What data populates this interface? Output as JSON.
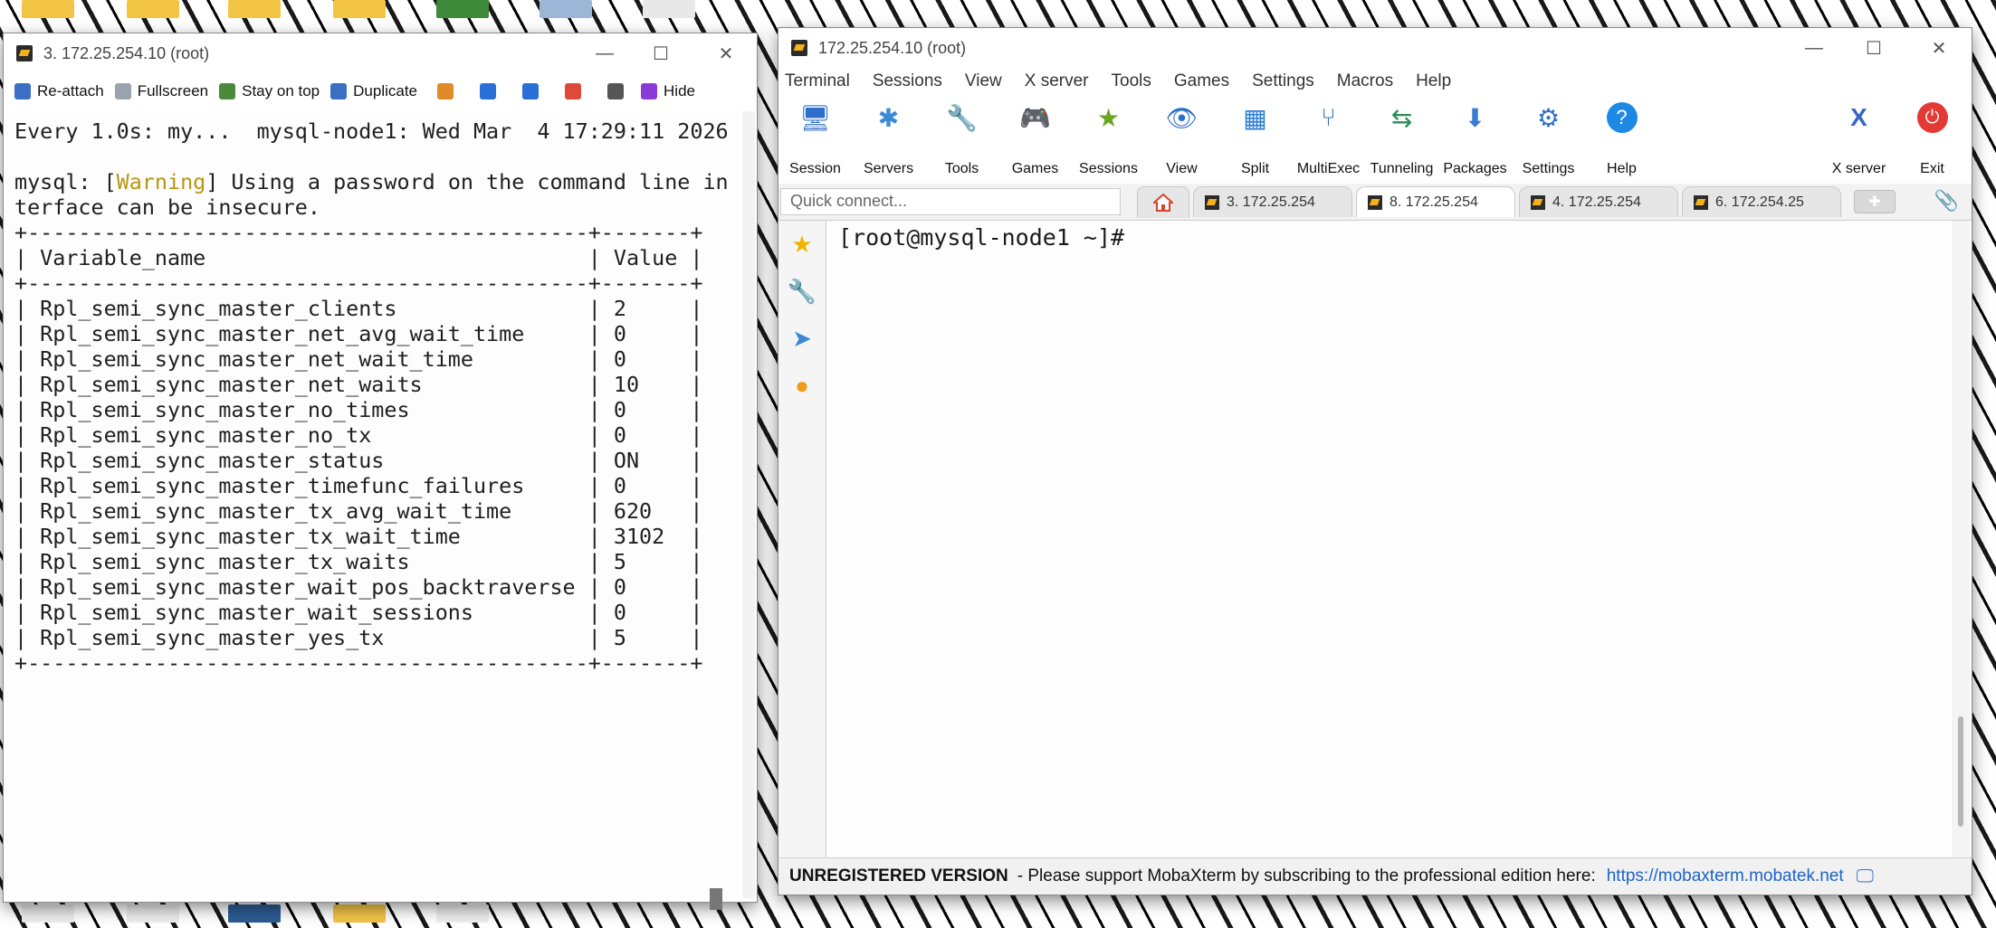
{
  "left_window": {
    "title": "3. 172.25.254.10 (root)",
    "controls": {
      "minimize": "—",
      "maximize": "☐",
      "close": "✕"
    },
    "toolbar": [
      {
        "label": "Re-attach",
        "icon": "reattach-icon",
        "color": "#3a6fc4"
      },
      {
        "label": "Fullscreen",
        "icon": "fullscreen-icon",
        "color": "#9aa3ad"
      },
      {
        "label": "Stay on top",
        "icon": "pin-icon",
        "color": "#4a8a3a"
      },
      {
        "label": "Duplicate",
        "icon": "duplicate-icon",
        "color": "#3a6fc4"
      },
      {
        "label": "",
        "icon": "edit-icon",
        "color": "#e08a2a"
      },
      {
        "label": "",
        "icon": "zoom-in-icon",
        "color": "#2a6fd8"
      },
      {
        "label": "",
        "icon": "zoom-out-icon",
        "color": "#2a6fd8"
      },
      {
        "label": "",
        "icon": "save-icon",
        "color": "#e0483a"
      },
      {
        "label": "",
        "icon": "print-icon",
        "color": "#555555"
      },
      {
        "label": "Hide",
        "icon": "lightning-icon",
        "color": "#8a3ad8"
      }
    ],
    "terminal": {
      "watch_header": "Every 1.0s: my...  mysql-node1: Wed Mar  4 17:29:11 2026",
      "warning_prefix": "mysql: [",
      "warning_word": "Warning",
      "warning_rest": "] Using a password on the command line in",
      "warning_line2": "terface can be insecure.",
      "border": "+--------------------------------------------+-------+",
      "header_row": "| Variable_name                              | Value |",
      "rows": [
        "| Rpl_semi_sync_master_clients               | 2     |",
        "| Rpl_semi_sync_master_net_avg_wait_time     | 0     |",
        "| Rpl_semi_sync_master_net_wait_time         | 0     |",
        "| Rpl_semi_sync_master_net_waits             | 10    |",
        "| Rpl_semi_sync_master_no_times              | 0     |",
        "| Rpl_semi_sync_master_no_tx                 | 0     |",
        "| Rpl_semi_sync_master_status                | ON    |",
        "| Rpl_semi_sync_master_timefunc_failures     | 0     |",
        "| Rpl_semi_sync_master_tx_avg_wait_time      | 620   |",
        "| Rpl_semi_sync_master_tx_wait_time          | 3102  |",
        "| Rpl_semi_sync_master_tx_waits              | 5     |",
        "| Rpl_semi_sync_master_wait_pos_backtraverse | 0     |",
        "| Rpl_semi_sync_master_wait_sessions         | 0     |",
        "| Rpl_semi_sync_master_yes_tx                | 5     |"
      ]
    }
  },
  "right_window": {
    "title": "172.25.254.10 (root)",
    "controls": {
      "minimize": "—",
      "maximize": "☐",
      "close": "✕"
    },
    "menu": [
      "Terminal",
      "Sessions",
      "View",
      "X server",
      "Tools",
      "Games",
      "Settings",
      "Macros",
      "Help"
    ],
    "toolbar": [
      {
        "label": "Session",
        "icon": "session-icon",
        "glyph": "🖥"
      },
      {
        "label": "Servers",
        "icon": "servers-icon",
        "glyph": "✱"
      },
      {
        "label": "Tools",
        "icon": "tools-icon",
        "glyph": "🔧"
      },
      {
        "label": "Games",
        "icon": "games-icon",
        "glyph": "🎮"
      },
      {
        "label": "Sessions",
        "icon": "star-icon",
        "glyph": "★"
      },
      {
        "label": "View",
        "icon": "view-icon",
        "glyph": "👁"
      },
      {
        "label": "Split",
        "icon": "split-icon",
        "glyph": "▦"
      },
      {
        "label": "MultiExec",
        "icon": "multiexec-icon",
        "glyph": "⑂"
      },
      {
        "label": "Tunneling",
        "icon": "tunneling-icon",
        "glyph": "⇆"
      },
      {
        "label": "Packages",
        "icon": "packages-icon",
        "glyph": "⬇"
      },
      {
        "label": "Settings",
        "icon": "settings-icon",
        "glyph": "⚙"
      },
      {
        "label": "Help",
        "icon": "help-icon",
        "glyph": "?"
      }
    ],
    "toolbar_right": [
      {
        "label": "X server",
        "icon": "xserver-icon",
        "glyph": "X"
      },
      {
        "label": "Exit",
        "icon": "exit-icon",
        "glyph": "⏻"
      }
    ],
    "quick_connect_placeholder": "Quick connect...",
    "tabs": [
      {
        "label": "3. 172.25.254",
        "active": false
      },
      {
        "label": "8. 172.25.254",
        "active": true
      },
      {
        "label": "4. 172.25.254",
        "active": false
      },
      {
        "label": "6. 172.254.25",
        "active": false
      }
    ],
    "terminal": {
      "prompt": "[root@mysql-node1 ~]#"
    },
    "status": {
      "unregistered": "UNREGISTERED VERSION",
      "message": "-  Please support MobaXterm by subscribing to the professional edition here:",
      "link": "https://mobaxterm.mobatek.net"
    }
  }
}
